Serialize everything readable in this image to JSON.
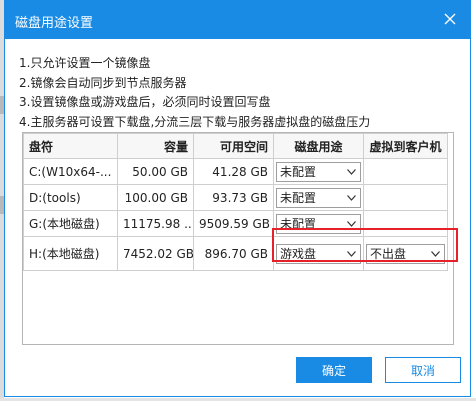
{
  "dialog": {
    "title": "磁盘用途设置"
  },
  "notes": [
    "1.只允许设置一个镜像盘",
    "2.镜像会自动同步到节点服务器",
    "3.设置镜像盘或游戏盘后，必须同时设置回写盘",
    "4.主服务器可设置下载盘,分流三层下载与服务器虚拟盘的磁盘压力"
  ],
  "table": {
    "headers": [
      "盘符",
      "容量",
      "可用空间",
      "磁盘用途",
      "虚拟到客户机"
    ],
    "rows": [
      {
        "drive": "C:(W10x64-...",
        "capacity": "50.00 GB",
        "free": "41.28 GB",
        "usage": "未配置",
        "client": ""
      },
      {
        "drive": "D:(tools)",
        "capacity": "100.00 GB",
        "free": "93.73 GB",
        "usage": "未配置",
        "client": ""
      },
      {
        "drive": "G:(本地磁盘)",
        "capacity": "11175.98 ...",
        "free": "9509.59 GB",
        "usage": "未配置",
        "client": ""
      },
      {
        "drive": "H:(本地磁盘)",
        "capacity": "7452.02 GB",
        "free": "896.70 GB",
        "usage": "游戏盘",
        "client": "不出盘"
      }
    ]
  },
  "buttons": {
    "ok": "确定",
    "cancel": "取消"
  },
  "colors": {
    "accent": "#1a8be4",
    "highlight": "#e6212a"
  }
}
